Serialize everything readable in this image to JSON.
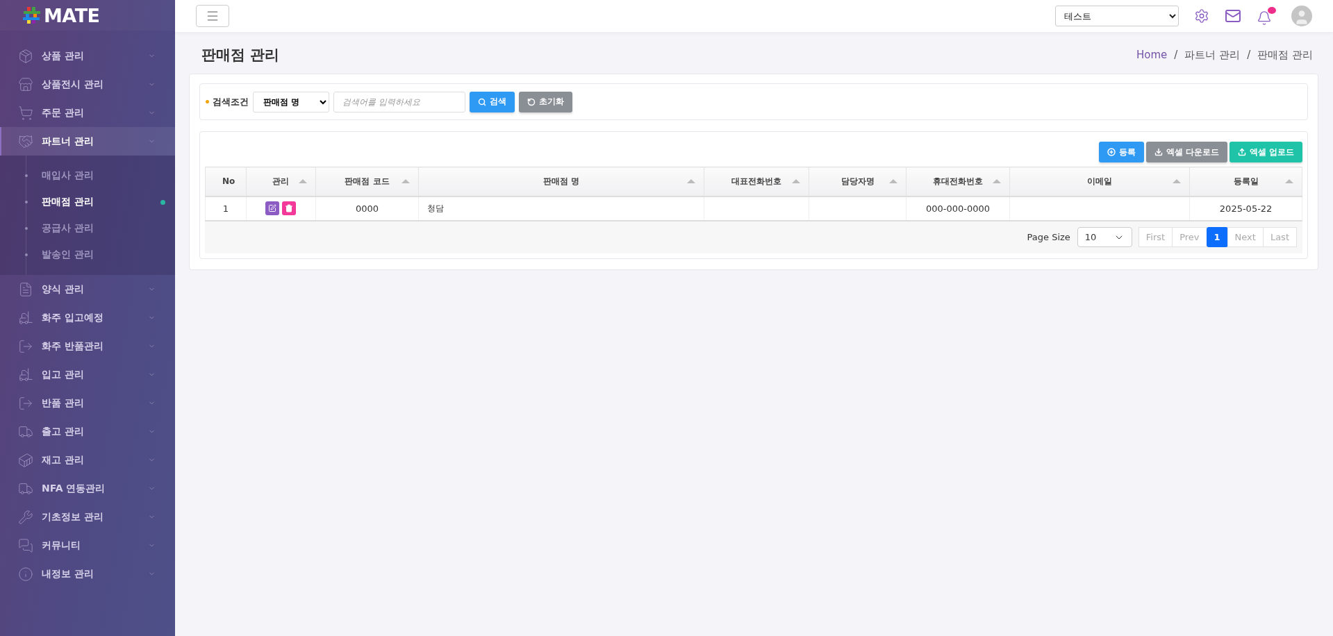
{
  "logo": {
    "text": "MATE"
  },
  "sidebar": {
    "items": [
      {
        "label": "상품 관리",
        "selected": false
      },
      {
        "label": "상품전시 관리",
        "selected": false
      },
      {
        "label": "주문 관리",
        "selected": false
      },
      {
        "label": "파트너 관리",
        "selected": true,
        "children": [
          {
            "label": "매입사 관리",
            "selected": false
          },
          {
            "label": "판매점 관리",
            "selected": true
          },
          {
            "label": "공급사 관리",
            "selected": false
          },
          {
            "label": "발송인 관리",
            "selected": false
          }
        ]
      },
      {
        "label": "양식 관리",
        "selected": false
      },
      {
        "label": "화주 입고예정",
        "selected": false
      },
      {
        "label": "화주 반품관리",
        "selected": false
      },
      {
        "label": "입고 관리",
        "selected": false
      },
      {
        "label": "반품 관리",
        "selected": false
      },
      {
        "label": "출고 관리",
        "selected": false
      },
      {
        "label": "재고 관리",
        "selected": false
      },
      {
        "label": "NFA 연동관리",
        "selected": false
      },
      {
        "label": "기초정보 관리",
        "selected": false
      },
      {
        "label": "커뮤니티",
        "selected": false
      },
      {
        "label": "내정보 관리",
        "selected": false
      }
    ]
  },
  "header": {
    "company_select": "테스트",
    "has_notification": true
  },
  "page": {
    "title": "판매점 관리",
    "breadcrumb": {
      "separator": "/",
      "items": [
        "Home",
        "파트너 관리",
        "판매점 관리"
      ]
    }
  },
  "search": {
    "label": "검색조건",
    "field_select": "판매점 명",
    "placeholder": "검색어를 입력하세요",
    "buttons": [
      {
        "kind": "search",
        "label": "검색"
      },
      {
        "kind": "reset",
        "label": "초기화"
      }
    ]
  },
  "toolbar": [
    {
      "kind": "add",
      "label": "등록"
    },
    {
      "kind": "download",
      "label": "엑셀 다운로드"
    },
    {
      "kind": "upload",
      "label": "엑셀 업로드"
    }
  ],
  "table": {
    "columns": [
      {
        "label": "No",
        "sortable": false
      },
      {
        "label": "관리",
        "sortable": true
      },
      {
        "label": "판매점 코드",
        "sortable": true
      },
      {
        "label": "판매점 명",
        "sortable": true
      },
      {
        "label": "대표전화번호",
        "sortable": true
      },
      {
        "label": "담당자명",
        "sortable": true
      },
      {
        "label": "휴대전화번호",
        "sortable": true
      },
      {
        "label": "이메일",
        "sortable": true
      },
      {
        "label": "등록일",
        "sortable": true
      }
    ],
    "rows": [
      {
        "no": "1",
        "code": "0000",
        "name": "청담",
        "mobile": "000-000-0000",
        "registered": "2025-05-22"
      }
    ]
  },
  "pagination": {
    "page_size_label": "Page Size",
    "page_size": "10",
    "buttons": [
      {
        "label": "First",
        "selected": false,
        "disabled": true
      },
      {
        "label": "Prev",
        "selected": false,
        "disabled": true
      },
      {
        "label": "1",
        "selected": true,
        "disabled": false
      },
      {
        "label": "Next",
        "selected": false,
        "disabled": true
      },
      {
        "label": "Last",
        "selected": false,
        "disabled": true
      }
    ]
  }
}
